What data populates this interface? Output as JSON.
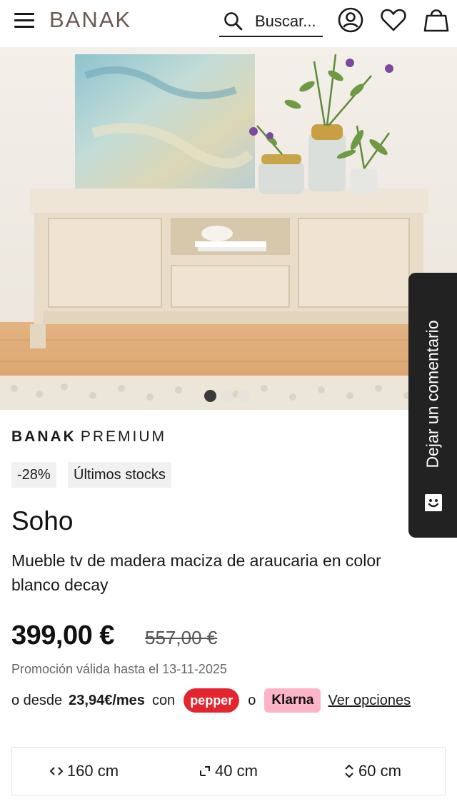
{
  "header": {
    "logo": "BANAK",
    "search_label": "Buscar..."
  },
  "hero": {
    "slide_count": 3,
    "active_slide": 1
  },
  "feedback_tab": {
    "label": "Dejar un comentario"
  },
  "product": {
    "brand": "BANAK",
    "line": "PREMIUM",
    "badges": [
      "-28%",
      "Últimos stocks"
    ],
    "name": "Soho",
    "description": "Mueble tv de madera maciza de araucaria en color blanco decay",
    "price": "399,00 €",
    "old_price": "557,00 €",
    "promo": "Promoción válida hasta el 13-11-2025",
    "financing": {
      "prefix": "o desde",
      "amount": "23,94€/mes",
      "with": "con",
      "pepper": "pepper",
      "or": "o",
      "klarna": "Klarna",
      "options_link": "Ver opciones"
    },
    "dimensions": [
      {
        "icon": "width-icon",
        "value": "160 cm"
      },
      {
        "icon": "depth-icon",
        "value": "40 cm"
      },
      {
        "icon": "height-icon",
        "value": "60 cm"
      }
    ]
  },
  "colors": {
    "logo": "#6b5a54",
    "pepper": "#e3262e",
    "klarna": "#ffb3c7",
    "feedback_bg": "#222222"
  }
}
